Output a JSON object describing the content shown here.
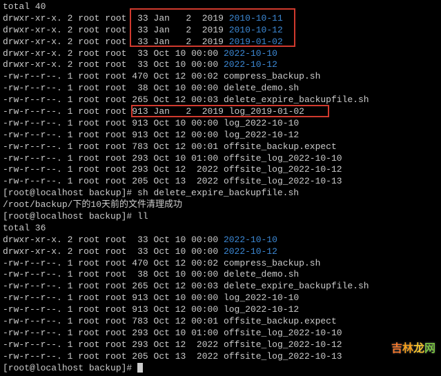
{
  "header_line": "total 40",
  "prompt_label": "[root@localhost backup]#",
  "cmd_run": "sh delete_expire_backupfile.sh",
  "success_msg": "/root/backup/下的10天前的文件清理成功",
  "cmd_ll": "ll",
  "after_total": "total 36",
  "watermark_chars": [
    "吉",
    "林",
    "龙",
    "网"
  ],
  "before": [
    {
      "perm": "drwxr-xr-x.",
      "n": "2",
      "own": "root root",
      "size": "33",
      "date": "Jan   2  2019",
      "name": "2010-10-11",
      "dir": true
    },
    {
      "perm": "drwxr-xr-x.",
      "n": "2",
      "own": "root root",
      "size": "33",
      "date": "Jan   2  2019",
      "name": "2010-10-12",
      "dir": true
    },
    {
      "perm": "drwxr-xr-x.",
      "n": "2",
      "own": "root root",
      "size": "33",
      "date": "Jan   2  2019",
      "name": "2019-01-02",
      "dir": true
    },
    {
      "perm": "drwxr-xr-x.",
      "n": "2",
      "own": "root root",
      "size": "33",
      "date": "Oct 10 00:00",
      "name": "2022-10-10",
      "dir": true
    },
    {
      "perm": "drwxr-xr-x.",
      "n": "2",
      "own": "root root",
      "size": "33",
      "date": "Oct 10 00:00",
      "name": "2022-10-12",
      "dir": true
    },
    {
      "perm": "-rw-r--r--.",
      "n": "1",
      "own": "root root",
      "size": "470",
      "date": "Oct 12 00:02",
      "name": "compress_backup.sh",
      "dir": false
    },
    {
      "perm": "-rw-r--r--.",
      "n": "1",
      "own": "root root",
      "size": "38",
      "date": "Oct 10 00:00",
      "name": "delete_demo.sh",
      "dir": false
    },
    {
      "perm": "-rw-r--r--.",
      "n": "1",
      "own": "root root",
      "size": "265",
      "date": "Oct 12 00:03",
      "name": "delete_expire_backupfile.sh",
      "dir": false
    },
    {
      "perm": "-rw-r--r--.",
      "n": "1",
      "own": "root root",
      "size": "913",
      "date": "Jan   2  2019",
      "name": "log_2019-01-02",
      "dir": false
    },
    {
      "perm": "-rw-r--r--.",
      "n": "1",
      "own": "root root",
      "size": "913",
      "date": "Oct 10 00:00",
      "name": "log_2022-10-10",
      "dir": false
    },
    {
      "perm": "-rw-r--r--.",
      "n": "1",
      "own": "root root",
      "size": "913",
      "date": "Oct 12 00:00",
      "name": "log_2022-10-12",
      "dir": false
    },
    {
      "perm": "-rw-r--r--.",
      "n": "1",
      "own": "root root",
      "size": "783",
      "date": "Oct 12 00:01",
      "name": "offsite_backup.expect",
      "dir": false
    },
    {
      "perm": "-rw-r--r--.",
      "n": "1",
      "own": "root root",
      "size": "293",
      "date": "Oct 10 01:00",
      "name": "offsite_log_2022-10-10",
      "dir": false
    },
    {
      "perm": "-rw-r--r--.",
      "n": "1",
      "own": "root root",
      "size": "293",
      "date": "Oct 12  2022",
      "name": "offsite_log_2022-10-12",
      "dir": false
    },
    {
      "perm": "-rw-r--r--.",
      "n": "1",
      "own": "root root",
      "size": "205",
      "date": "Oct 13  2022",
      "name": "offsite_log_2022-10-13",
      "dir": false
    }
  ],
  "after": [
    {
      "perm": "drwxr-xr-x.",
      "n": "2",
      "own": "root root",
      "size": "33",
      "date": "Oct 10 00:00",
      "name": "2022-10-10",
      "dir": true
    },
    {
      "perm": "drwxr-xr-x.",
      "n": "2",
      "own": "root root",
      "size": "33",
      "date": "Oct 10 00:00",
      "name": "2022-10-12",
      "dir": true
    },
    {
      "perm": "-rw-r--r--.",
      "n": "1",
      "own": "root root",
      "size": "470",
      "date": "Oct 12 00:02",
      "name": "compress_backup.sh",
      "dir": false
    },
    {
      "perm": "-rw-r--r--.",
      "n": "1",
      "own": "root root",
      "size": "38",
      "date": "Oct 10 00:00",
      "name": "delete_demo.sh",
      "dir": false
    },
    {
      "perm": "-rw-r--r--.",
      "n": "1",
      "own": "root root",
      "size": "265",
      "date": "Oct 12 00:03",
      "name": "delete_expire_backupfile.sh",
      "dir": false
    },
    {
      "perm": "-rw-r--r--.",
      "n": "1",
      "own": "root root",
      "size": "913",
      "date": "Oct 10 00:00",
      "name": "log_2022-10-10",
      "dir": false
    },
    {
      "perm": "-rw-r--r--.",
      "n": "1",
      "own": "root root",
      "size": "913",
      "date": "Oct 12 00:00",
      "name": "log_2022-10-12",
      "dir": false
    },
    {
      "perm": "-rw-r--r--.",
      "n": "1",
      "own": "root root",
      "size": "783",
      "date": "Oct 12 00:01",
      "name": "offsite_backup.expect",
      "dir": false
    },
    {
      "perm": "-rw-r--r--.",
      "n": "1",
      "own": "root root",
      "size": "293",
      "date": "Oct 10 01:00",
      "name": "offsite_log_2022-10-10",
      "dir": false
    },
    {
      "perm": "-rw-r--r--.",
      "n": "1",
      "own": "root root",
      "size": "293",
      "date": "Oct 12  2022",
      "name": "offsite_log_2022-10-12",
      "dir": false
    },
    {
      "perm": "-rw-r--r--.",
      "n": "1",
      "own": "root root",
      "size": "205",
      "date": "Oct 13  2022",
      "name": "offsite_log_2022-10-13",
      "dir": false
    }
  ]
}
